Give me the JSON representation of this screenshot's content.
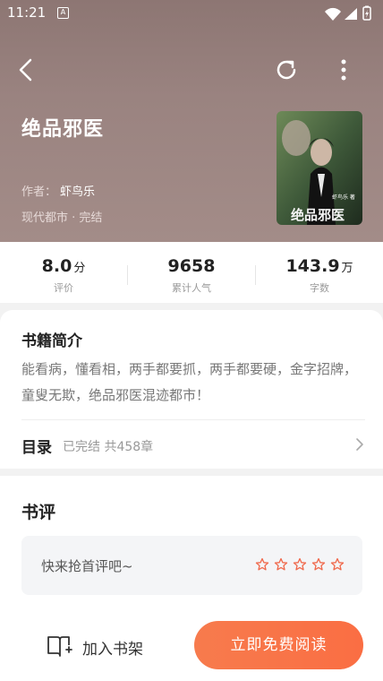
{
  "status_bar": {
    "time": "11:21",
    "notification_icon": "A"
  },
  "book": {
    "title": "绝品邪医",
    "author_label": "作者：",
    "author": "虾鸟乐",
    "category": "现代都市 · 完结",
    "cover": {
      "author_text": "虾鸟乐 著",
      "title_text": "绝品邪医"
    }
  },
  "stats": [
    {
      "value": "8.0",
      "unit": "分",
      "label": "评价"
    },
    {
      "value": "9658",
      "unit": "",
      "label": "累计人气"
    },
    {
      "value": "143.9",
      "unit": "万",
      "label": "字数"
    }
  ],
  "intro": {
    "heading": "书籍简介",
    "text": "能看病，懂看相，两手都要抓，两手都要硬，金字招牌，童叟无欺，绝品邪医混迹都市！"
  },
  "toc": {
    "label": "目录",
    "info": "已完结 共458章"
  },
  "reviews": {
    "heading": "书评",
    "prompt": "快来抢首评吧~",
    "rating_stars": 5,
    "star_color": "#f06a4d"
  },
  "bottom": {
    "shelf_label": "加入书架",
    "read_label": "立即免费阅读"
  },
  "colors": {
    "hero_bg": "#9a8380",
    "accent": "#f7764a"
  }
}
